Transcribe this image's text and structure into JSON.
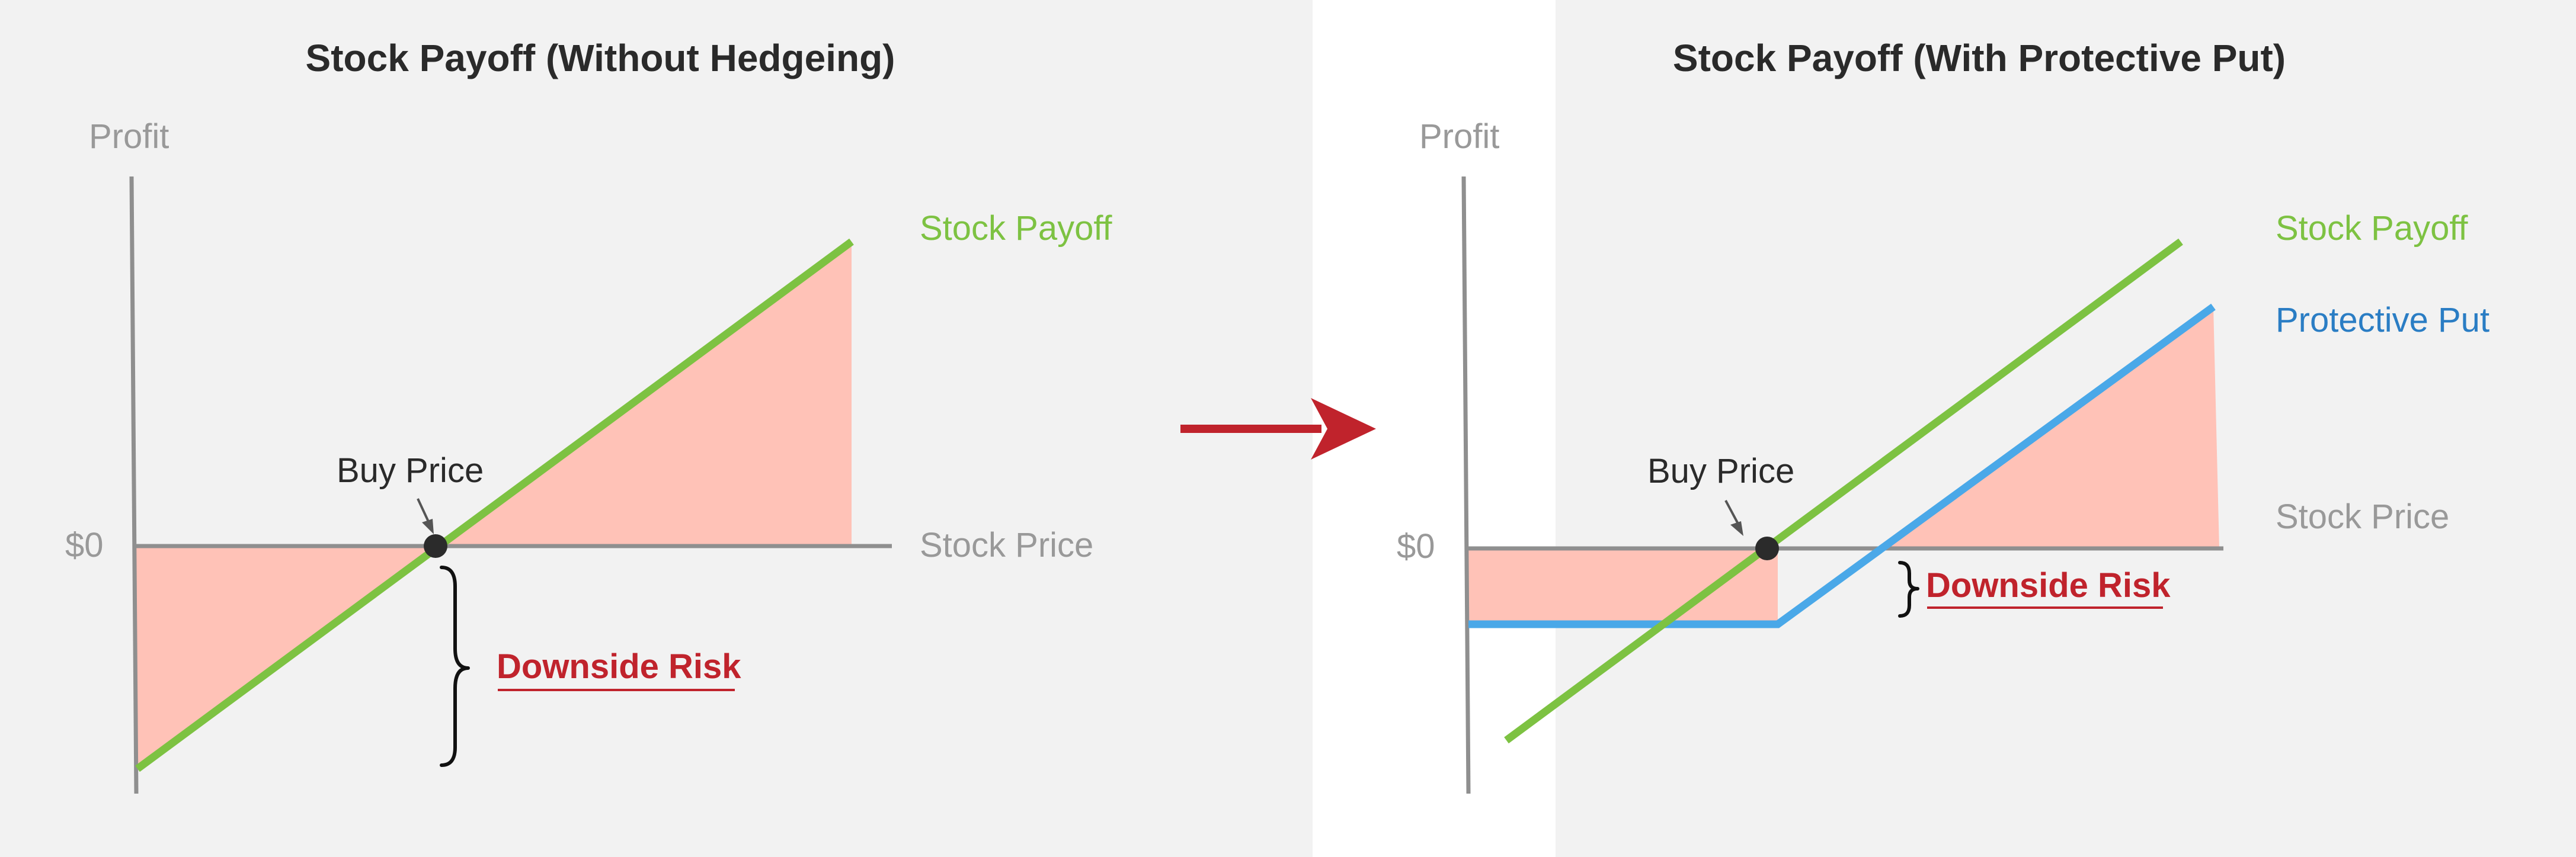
{
  "colors": {
    "stock_payoff": "#7dc242",
    "protective_put": "#4aa8e8",
    "risk_fill": "#ffc2b7",
    "risk_text": "#c0232c",
    "arrow": "#c0232c",
    "axis": "#8f8f8f",
    "buy_point": "#2b2b2b"
  },
  "panels": {
    "left": {
      "title": "Stock Payoff (Without Hedgeing)",
      "y_axis_label": "Profit",
      "x_axis_label": "Stock Price",
      "zero_label": "$0",
      "series": [
        {
          "name": "Stock Payoff",
          "color_key": "stock_payoff"
        }
      ],
      "buy_label": "Buy Price",
      "risk_label": "Downside Risk"
    },
    "right": {
      "title": "Stock Payoff (With Protective Put)",
      "y_axis_label": "Profit",
      "x_axis_label": "Stock Price",
      "zero_label": "$0",
      "series": [
        {
          "name": "Stock Payoff",
          "color_key": "stock_payoff"
        },
        {
          "name": "Protective Put",
          "color_key": "protective_put"
        }
      ],
      "buy_label": "Buy Price",
      "risk_label": "Downside Risk"
    }
  },
  "transition_arrow_icon": "right-arrow-icon"
}
